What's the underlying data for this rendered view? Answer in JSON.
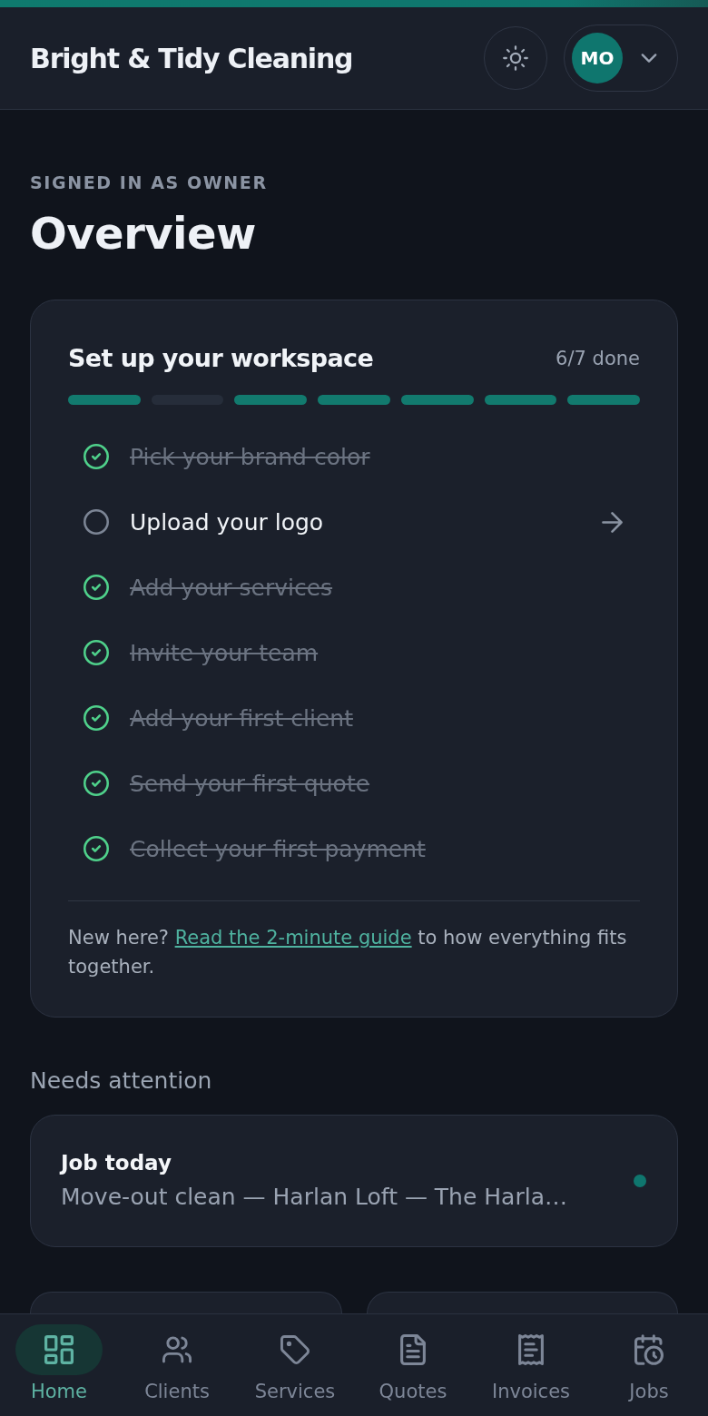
{
  "header": {
    "title": "Bright & Tidy Cleaning",
    "avatar_initials": "MO"
  },
  "overview": {
    "eyebrow": "SIGNED IN AS OWNER",
    "title": "Overview"
  },
  "setup": {
    "title": "Set up your workspace",
    "progress": "6/7 done",
    "items": [
      {
        "label": "Pick your brand color",
        "done": true
      },
      {
        "label": "Upload your logo",
        "done": false
      },
      {
        "label": "Add your services",
        "done": true
      },
      {
        "label": "Invite your team",
        "done": true
      },
      {
        "label": "Add your first client",
        "done": true
      },
      {
        "label": "Send your first quote",
        "done": true
      },
      {
        "label": "Collect your first payment",
        "done": true
      }
    ],
    "note": {
      "text_before": "New here? ",
      "link": "Read the 2-minute guide",
      "text_after": " to how everything fits together."
    }
  },
  "attention": {
    "heading": "Needs attention",
    "items": [
      {
        "title": "Job today",
        "detail": "Move-out clean — Harlan Loft — The Harla…",
        "color": "#0f766e"
      }
    ]
  },
  "nav": {
    "tabs": [
      {
        "label": "Home",
        "selected": true
      },
      {
        "label": "Clients",
        "selected": false
      },
      {
        "label": "Services",
        "selected": false
      },
      {
        "label": "Quotes",
        "selected": false
      },
      {
        "label": "Invoices",
        "selected": false
      },
      {
        "label": "Jobs",
        "selected": false
      }
    ]
  }
}
